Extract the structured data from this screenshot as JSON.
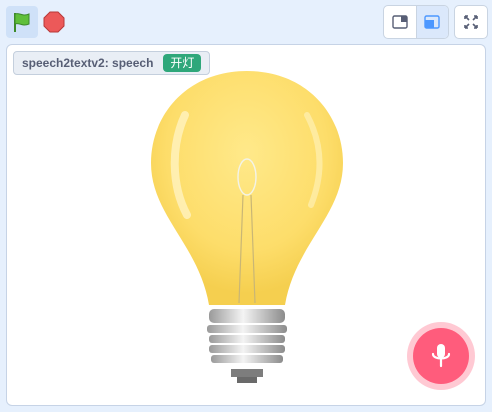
{
  "toolbar": {
    "green_flag_icon": "green-flag-icon",
    "stop_icon": "stop-sign-icon",
    "small_stage_icon": "small-stage-icon",
    "large_stage_icon": "large-stage-icon",
    "fullscreen_icon": "fullscreen-icon"
  },
  "stage": {
    "monitor": {
      "label": "speech2textv2: speech",
      "value": "开灯"
    },
    "sprite_icon": "light-bulb",
    "mic_icon": "microphone-icon"
  },
  "colors": {
    "accent": "#2ea77a",
    "mic": "#ff5c7c",
    "bulb": "#fde27a"
  }
}
